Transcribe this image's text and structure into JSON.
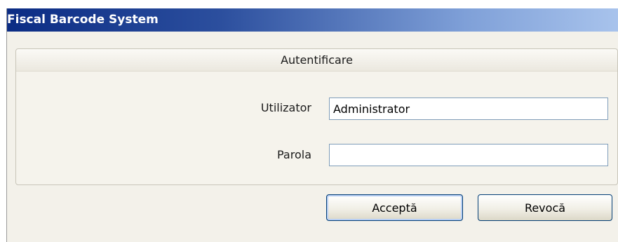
{
  "window": {
    "title": "Fiscal Barcode System"
  },
  "login": {
    "group_title": "Autentificare",
    "user_label": "Utilizator",
    "user_value": "Administrator",
    "password_label": "Parola",
    "password_value": ""
  },
  "buttons": {
    "accept_label": "Acceptă",
    "cancel_label": "Revocă"
  },
  "colors": {
    "titlebar_start": "#0b2c84",
    "titlebar_end": "#a8c3ec",
    "window_background": "#f3f1ea",
    "input_border": "#7f9db9"
  }
}
